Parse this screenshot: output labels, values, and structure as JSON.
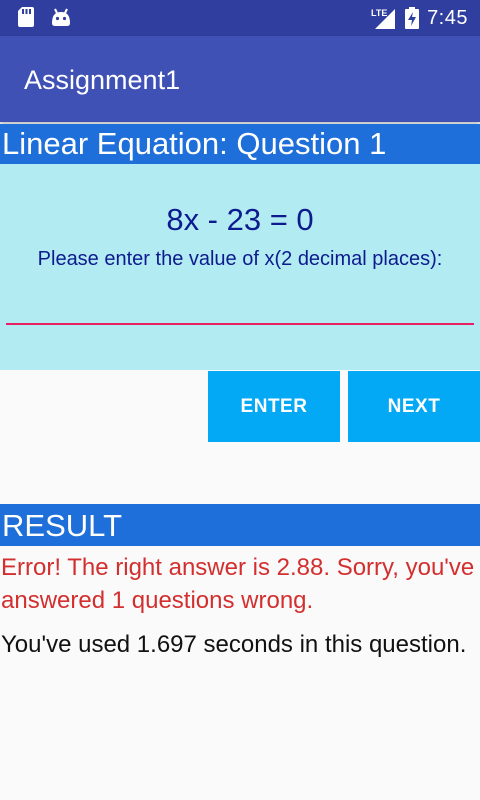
{
  "status_bar": {
    "time": "7:45",
    "network_label": "LTE",
    "icons": [
      "sd-card-icon",
      "android-icon",
      "signal-icon",
      "battery-charging-icon"
    ]
  },
  "app_bar": {
    "title": "Assignment1"
  },
  "question": {
    "header": "Linear Equation: Question 1",
    "equation": "8x - 23 = 0",
    "prompt": "Please enter the value of x(2 decimal places):",
    "input_value": "",
    "input_placeholder": ""
  },
  "buttons": {
    "enter_label": "ENTER",
    "next_label": "NEXT"
  },
  "result": {
    "header": "RESULT",
    "error_message": "Error! The right answer is 2.88. Sorry, you've answered 1 questions wrong.",
    "time_message": "You've used 1.697 seconds in this question."
  },
  "colors": {
    "status_bar": "#303f9f",
    "app_bar": "#3f51b5",
    "section_header": "#1e6fd9",
    "question_panel": "#b3ebf2",
    "button": "#03a9f4",
    "input_underline": "#e91e63",
    "error_text": "#d32f2f",
    "question_text": "#0d1b8f"
  }
}
